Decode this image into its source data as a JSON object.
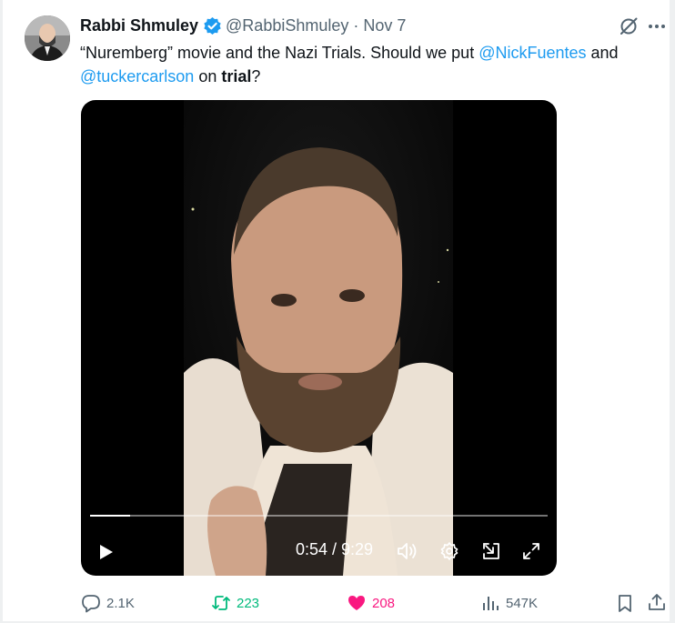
{
  "tweet": {
    "author_name": "Rabbi Shmuley",
    "handle": "@RabbiShmuley",
    "separator": "·",
    "date": "Nov 7",
    "text_prefix": "“Nuremberg” movie and the Nazi Trials. Should we put ",
    "mention_1": "@NickFuentes",
    "text_and": " and",
    "mention_2": "@tuckercarlson",
    "text_on": " on ",
    "text_bold": "trial",
    "text_suffix": "?"
  },
  "video": {
    "time": "0:54 / 9:29",
    "progress": 0.088
  },
  "actions": {
    "replies": "2.1K",
    "reposts": "223",
    "likes": "208",
    "views": "547K"
  },
  "colors": {
    "accent": "#1d9bf0",
    "repost": "#00ba7c",
    "like": "#f91880",
    "muted": "#536471"
  },
  "icons": [
    "verified-badge-icon",
    "grok-icon",
    "more-icon",
    "play-icon",
    "volume-icon",
    "settings-icon",
    "pip-icon",
    "fullscreen-icon",
    "reply-icon",
    "retweet-icon",
    "heart-icon",
    "views-icon",
    "bookmark-icon",
    "share-icon"
  ]
}
